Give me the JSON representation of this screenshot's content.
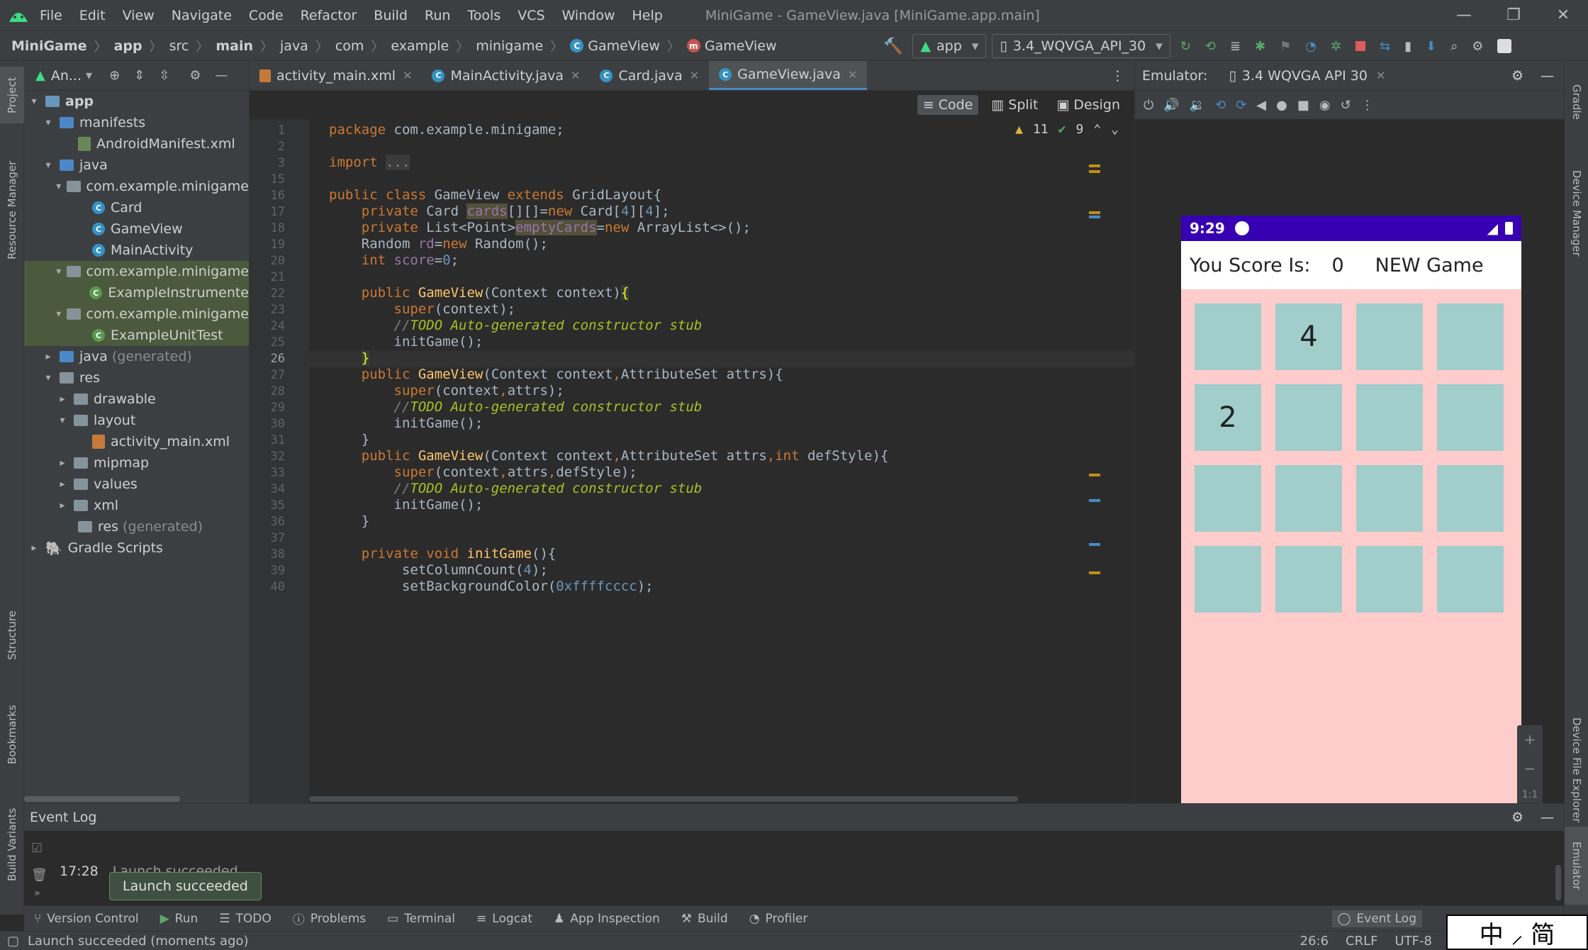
{
  "menubar": {
    "items": [
      "File",
      "Edit",
      "View",
      "Navigate",
      "Code",
      "Refactor",
      "Build",
      "Run",
      "Tools",
      "VCS",
      "Window",
      "Help"
    ],
    "window_title": "MiniGame - GameView.java [MiniGame.app.main]"
  },
  "navbar": {
    "crumbs": [
      "MiniGame",
      "app",
      "src",
      "main",
      "java",
      "com",
      "example",
      "minigame",
      "GameView",
      "GameView"
    ],
    "run_config": "app",
    "device": "3.4_WQVGA_API_30"
  },
  "project": {
    "header": "An...",
    "tree": [
      {
        "label": "app",
        "bold": true
      },
      {
        "label": "manifests"
      },
      {
        "label": "AndroidManifest.xml"
      },
      {
        "label": "java"
      },
      {
        "label": "com.example.minigame"
      },
      {
        "label": "Card"
      },
      {
        "label": "GameView"
      },
      {
        "label": "MainActivity"
      },
      {
        "label": "com.example.minigame"
      },
      {
        "label": "ExampleInstrumente"
      },
      {
        "label": "com.example.minigame"
      },
      {
        "label": "ExampleUnitTest"
      },
      {
        "label": "java",
        "suffix": "(generated)"
      },
      {
        "label": "res"
      },
      {
        "label": "drawable"
      },
      {
        "label": "layout"
      },
      {
        "label": "activity_main.xml"
      },
      {
        "label": "mipmap"
      },
      {
        "label": "values"
      },
      {
        "label": "xml"
      },
      {
        "label": "res",
        "suffix": "(generated)"
      },
      {
        "label": "Gradle Scripts"
      }
    ]
  },
  "editor": {
    "tabs": [
      "activity_main.xml",
      "MainActivity.java",
      "Card.java",
      "GameView.java"
    ],
    "active_tab": "GameView.java",
    "view_modes": [
      "Code",
      "Split",
      "Design"
    ],
    "warnings": "11",
    "weak_warnings": "9",
    "line_numbers": [
      "1",
      "2",
      "3",
      "15",
      "16",
      "17",
      "18",
      "19",
      "20",
      "21",
      "22",
      "23",
      "24",
      "25",
      "26",
      "27",
      "28",
      "29",
      "30",
      "31",
      "32",
      "33",
      "34",
      "35",
      "36",
      "37",
      "38",
      "39",
      "40"
    ],
    "current_line": "26"
  },
  "emulator": {
    "label": "Emulator:",
    "device_tab": "3.4 WQVGA API 30",
    "phone": {
      "time": "9:29",
      "score_label": "You Score Is:",
      "score_value": "0",
      "new_game": "NEW Game",
      "grid": [
        "",
        "4",
        "",
        "",
        "2",
        "",
        "",
        "",
        "",
        "",
        "",
        "",
        "",
        "",
        "",
        ""
      ],
      "bg_color": "#ffcccc",
      "cell_color": "#a1cdcb"
    },
    "zoom": [
      "+",
      "−",
      "1:1"
    ]
  },
  "eventlog": {
    "title": "Event Log",
    "entry_time": "17:28",
    "entry_text": "Launch succeeded",
    "toast": "Launch succeeded"
  },
  "toolwindows": [
    "Version Control",
    "Run",
    "TODO",
    "Problems",
    "Terminal",
    "Logcat",
    "App Inspection",
    "Build",
    "Profiler"
  ],
  "toolwindows_right": "Event Log",
  "left_strip": [
    "Project",
    "Resource Manager",
    "Structure",
    "Bookmarks",
    "Build Variants"
  ],
  "right_strip": [
    "Gradle",
    "Device Manager",
    "Device File Explorer",
    "Emulator"
  ],
  "statusline": {
    "message": "Launch succeeded (moments ago)",
    "position": "26:6",
    "line_sep": "CRLF",
    "encoding": "UTF-8"
  },
  "ime": {
    "text": "中 ⸝ 简"
  }
}
